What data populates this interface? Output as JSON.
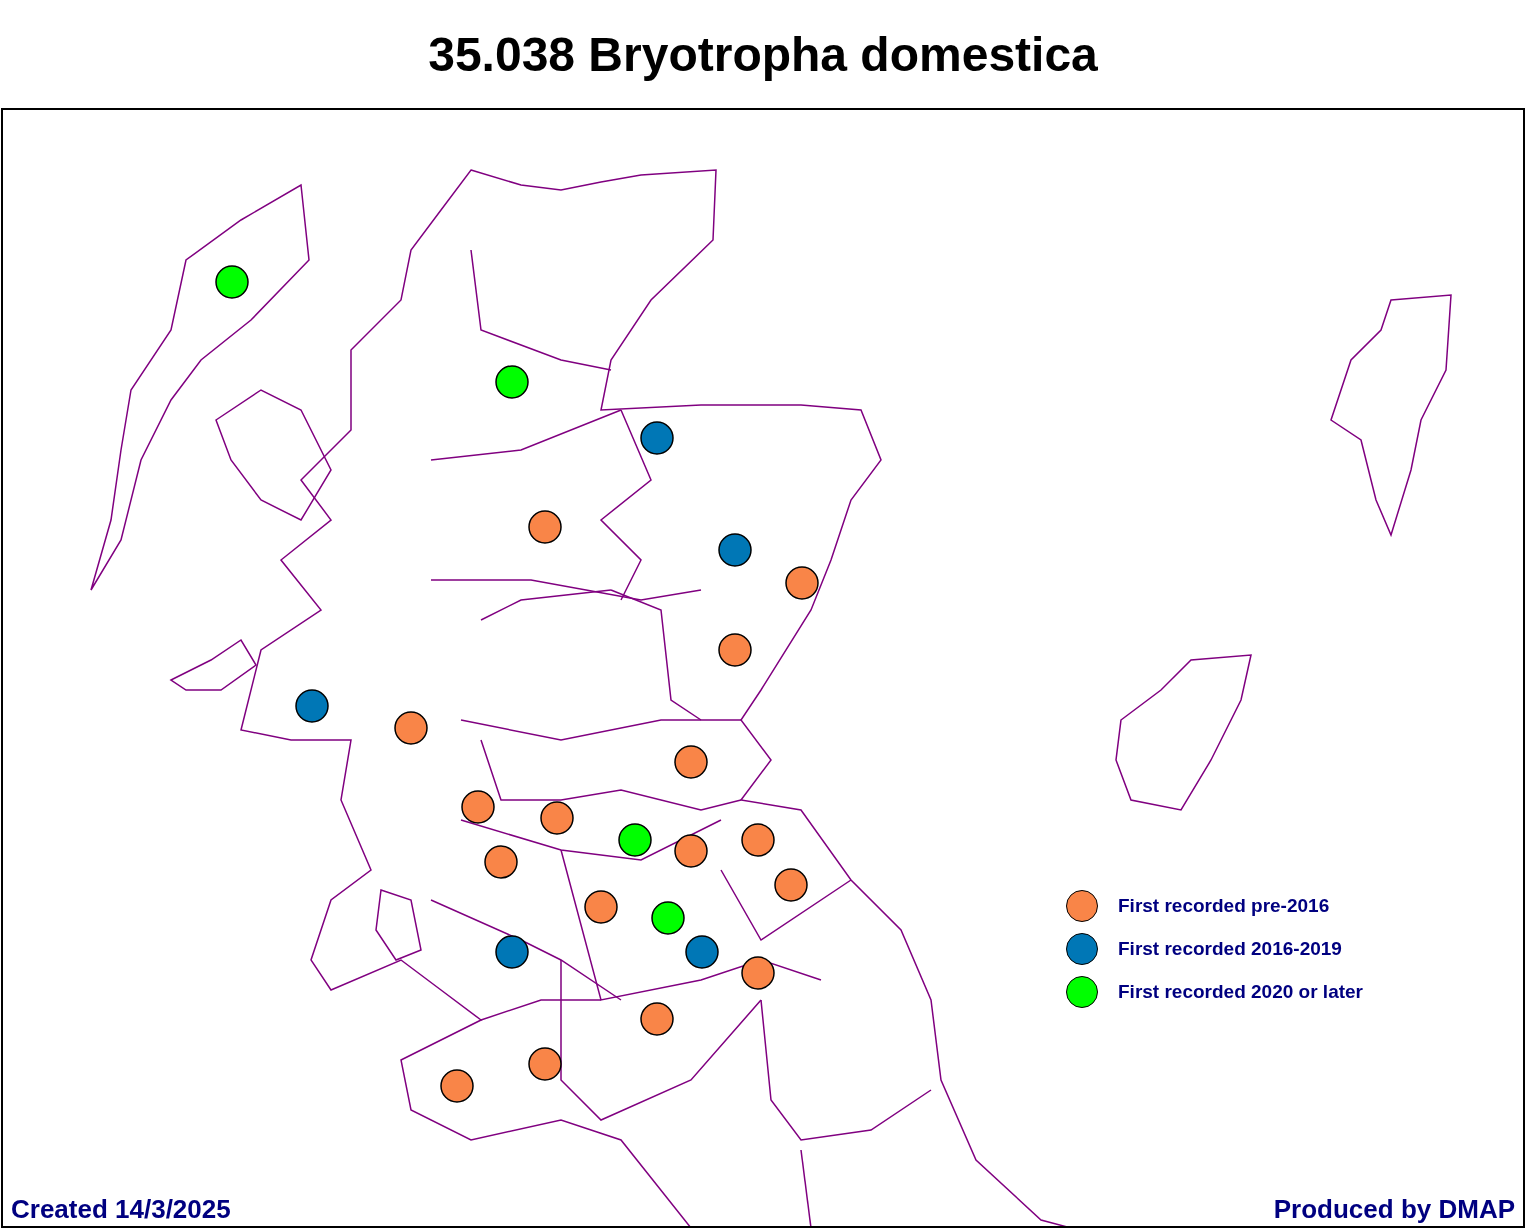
{
  "title": "35.038 Bryotropha domestica",
  "records": [
    {
      "color": "#00ff00"
    },
    {
      "color": "#00ff00"
    },
    {
      "color": "#0077b6"
    },
    {
      "color": "#f98548"
    },
    {
      "color": "#0077b6"
    },
    {
      "color": "#f98548"
    },
    {
      "color": "#f98548"
    },
    {
      "color": "#0077b6"
    },
    {
      "color": "#f98548"
    },
    {
      "color": "#f98548"
    },
    {
      "color": "#f98548"
    },
    {
      "color": "#f98548"
    },
    {
      "color": "#00ff00"
    },
    {
      "color": "#f98548"
    },
    {
      "color": "#f98548"
    },
    {
      "color": "#f98548"
    },
    {
      "color": "#f98548"
    },
    {
      "color": "#f98548"
    },
    {
      "color": "#00ff00"
    },
    {
      "color": "#0077b6"
    },
    {
      "color": "#0077b6"
    },
    {
      "color": "#f98548"
    },
    {
      "color": "#f98548"
    },
    {
      "color": "#f98548"
    },
    {
      "color": "#f98548"
    }
  ],
  "legend": [
    {
      "label": "First recorded pre-2016",
      "color": "#f98548"
    },
    {
      "label": "First recorded 2016-2019",
      "color": "#0077b6"
    },
    {
      "label": "First recorded 2020 or later",
      "color": "#00ff00"
    }
  ],
  "footer": {
    "created": "Created 14/3/2025",
    "produced": "Produced by DMAP"
  }
}
